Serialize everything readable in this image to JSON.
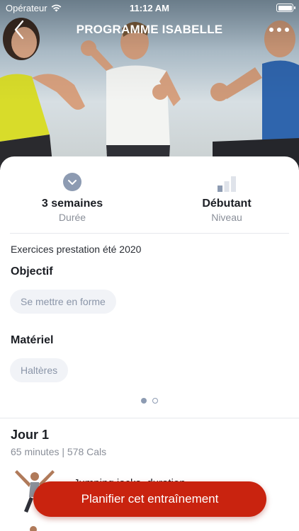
{
  "status_bar": {
    "carrier": "Opérateur",
    "time": "11:12 AM"
  },
  "nav": {
    "title": "PROGRAMME ISABELLE",
    "back_icon": "chevron-left-icon",
    "more_icon": "more-dots-icon"
  },
  "stats": [
    {
      "value": "3 semaines",
      "label": "Durée",
      "icon": "chevron-down-circle-icon"
    },
    {
      "value": "Débutant",
      "label": "Niveau",
      "icon": "signal-bars-icon",
      "level_filled": 1,
      "level_total": 3
    }
  ],
  "description": "Exercices prestation été 2020",
  "objective": {
    "title": "Objectif",
    "tag": "Se mettre en forme"
  },
  "equipment": {
    "title": "Matériel",
    "tag": "Haltères"
  },
  "pager": {
    "count": 2,
    "active": 0
  },
  "day": {
    "title": "Jour 1",
    "meta": "65 minutes | 578 Cals",
    "exercises": [
      {
        "name": "Jumping jacks, duration"
      }
    ]
  },
  "cta": {
    "label": "Planifier cet entraînement"
  },
  "colors": {
    "accent": "#c9230f",
    "icon_gray": "#8d9bb2",
    "pill_bg": "#f1f3f7"
  }
}
